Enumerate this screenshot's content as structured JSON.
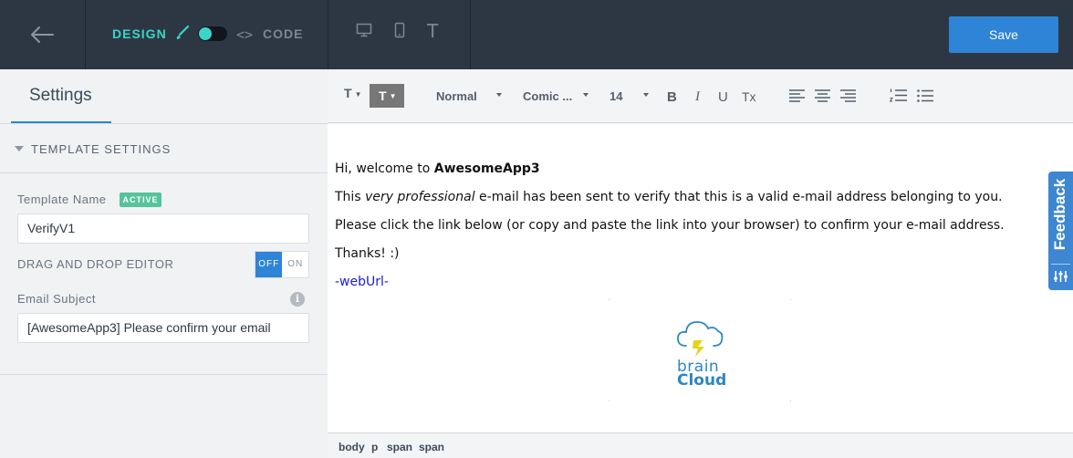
{
  "topbar": {
    "design_label": "DESIGN",
    "code_label": "CODE",
    "code_glyph": "<>",
    "text_glyph": "T",
    "save_label": "Save"
  },
  "left": {
    "tab_label": "Settings",
    "section_label": "TEMPLATE SETTINGS",
    "template_name_label": "Template Name",
    "active_badge": "ACTIVE",
    "template_name_value": "VerifyV1",
    "dnd_label": "DRAG AND DROP EDITOR",
    "off_label": "OFF",
    "on_label": "ON",
    "subject_label": "Email Subject",
    "info_glyph": "i",
    "subject_value": "[AwesomeApp3] Please confirm your email"
  },
  "toolbar": {
    "text_glyph": "T",
    "block_format": "Normal",
    "font_family": "Comic ...",
    "font_size": "14",
    "bold": "B",
    "italic": "I",
    "underline": "U",
    "clear_format": "Tx"
  },
  "email": {
    "greeting_prefix": "Hi, welcome to ",
    "app_name": "AwesomeApp3",
    "line2_prefix": "This ",
    "line2_em": "very professional",
    "line2_rest": " e-mail has been sent to verify that this is a valid e-mail address belonging to you.",
    "line3": "Please click the link below (or copy and paste the link into your browser) to confirm your e-mail address.",
    "line4": "Thanks! :)",
    "link": "-webUrl-",
    "logo_line1": "brain",
    "logo_line2": "Cloud"
  },
  "statusbar": {
    "crumbs": [
      "body",
      "p",
      "span",
      "span"
    ]
  },
  "feedback": {
    "label": "Feedback"
  },
  "colors": {
    "topbar_bg": "#2d3744",
    "accent_teal": "#3bd4c8",
    "save_blue": "#2e84d6",
    "badge_green": "#55c39c",
    "link_blue": "#1a1ae0",
    "feedback_blue": "#3d86d2"
  },
  "icons": [
    "back-arrow-icon",
    "brush-icon",
    "code-icon",
    "desktop-icon",
    "mobile-icon",
    "text-icon",
    "info-icon",
    "align-left-icon",
    "align-center-icon",
    "align-right-icon",
    "numbered-list-icon",
    "bullet-list-icon",
    "cloud-bolt-icon",
    "feedback-sliders-icon"
  ]
}
